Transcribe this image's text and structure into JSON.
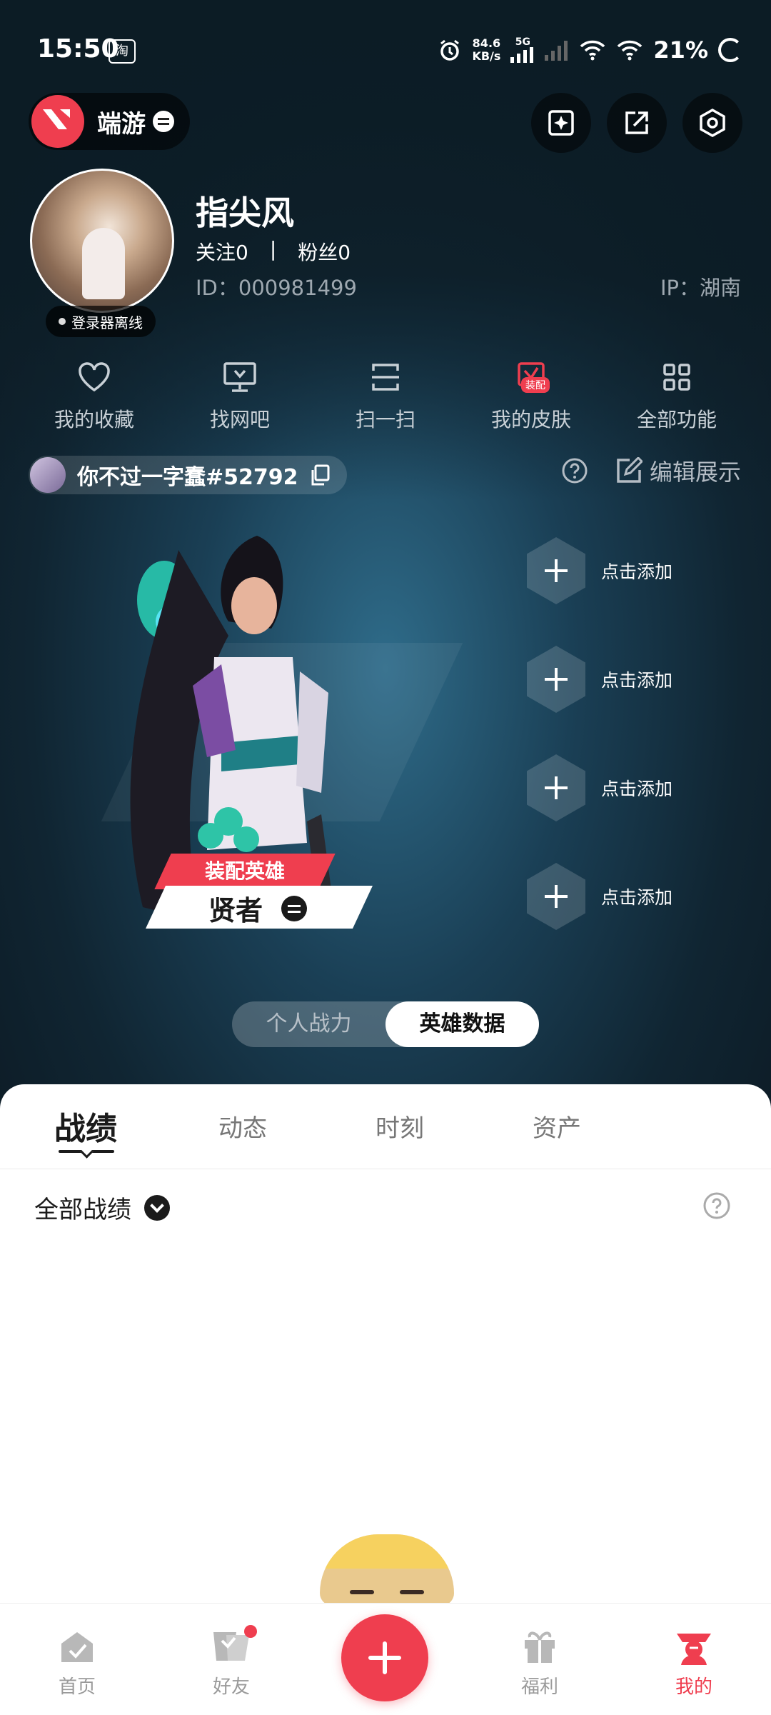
{
  "status_bar": {
    "time": "15:50",
    "taobao_icon": "淘",
    "speed_value": "84.6",
    "speed_unit": "KB/s",
    "network": "5G",
    "battery": "21%"
  },
  "header": {
    "app_name": "端游"
  },
  "profile": {
    "username": "指尖风",
    "follow_label": "关注",
    "follow_count": "0",
    "divider": "|",
    "fans_label": "粉丝",
    "fans_count": "0",
    "id": "ID：000981499",
    "ip": "IP：湖南",
    "offline_badge": "登录器离线"
  },
  "functions": [
    {
      "label": "我的收藏",
      "icon": "heart-icon"
    },
    {
      "label": "找网吧",
      "icon": "monitor-icon"
    },
    {
      "label": "扫一扫",
      "icon": "scan-icon"
    },
    {
      "label": "我的皮肤",
      "icon": "skin-icon",
      "tag": "装配"
    },
    {
      "label": "全部功能",
      "icon": "grid-icon"
    }
  ],
  "game_account": {
    "riot_id": "你不过一字蠢#52792",
    "edit_label": "编辑展示"
  },
  "hero": {
    "tag": "装配英雄",
    "name": "贤者"
  },
  "slots": [
    {
      "label": "点击添加"
    },
    {
      "label": "点击添加"
    },
    {
      "label": "点击添加"
    },
    {
      "label": "点击添加"
    }
  ],
  "toggle": {
    "left": "个人战力",
    "right": "英雄数据"
  },
  "tabs": [
    {
      "label": "战绩"
    },
    {
      "label": "动态"
    },
    {
      "label": "时刻"
    },
    {
      "label": "资产"
    }
  ],
  "filter": {
    "label": "全部战绩"
  },
  "bottom_nav": [
    {
      "label": "首页"
    },
    {
      "label": "好友"
    },
    {
      "label": "福利"
    },
    {
      "label": "我的"
    }
  ],
  "colors": {
    "accent": "#ef3e4f",
    "dark_bg": "#0c1c25"
  }
}
